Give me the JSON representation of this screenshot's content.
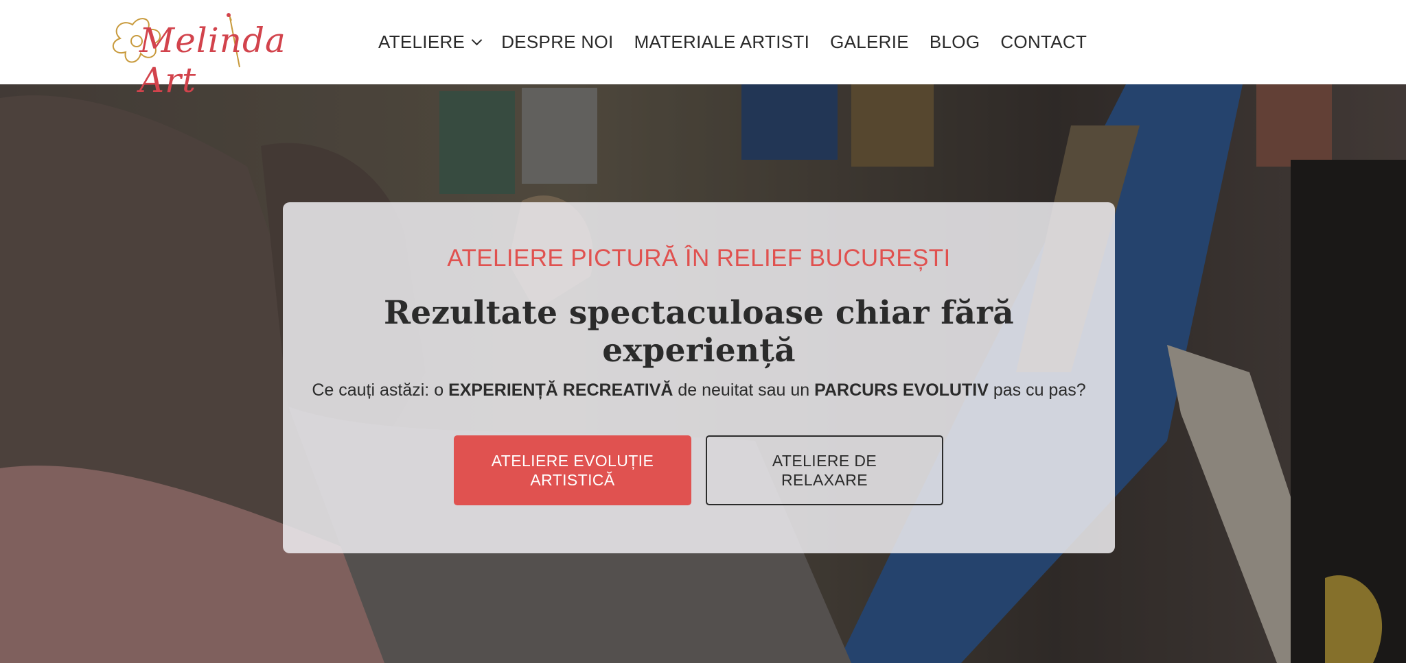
{
  "header": {
    "logo_text": "Melinda Art",
    "nav": [
      {
        "label": "ATELIERE",
        "has_dropdown": true
      },
      {
        "label": "DESPRE NOI"
      },
      {
        "label": "MATERIALE ARTISTI"
      },
      {
        "label": "GALERIE"
      },
      {
        "label": "BLOG"
      },
      {
        "label": "CONTACT"
      }
    ]
  },
  "hero": {
    "kicker": "ATELIERE PICTURĂ ÎN RELIEF BUCUREȘTI",
    "headline": "Rezultate spectaculoase chiar fără experiență",
    "tagline": {
      "part1": "Ce cauți astăzi: o ",
      "bold1": "EXPERIENȚĂ RECREATIVĂ",
      "part2": " de neuitat sau un ",
      "bold2": "PARCURS EVOLUTIV",
      "part3": " pas cu pas?"
    },
    "primary_button": "ATELIERE EVOLUȚIE ARTISTICĂ",
    "secondary_button": "ATELIERE DE RELAXARE"
  },
  "colors": {
    "accent": "#e05250",
    "text": "#2b2b2b",
    "card_bg": "#eeecf0"
  },
  "icons": {
    "logo": "flower-logo-icon",
    "dropdown": "chevron-down-icon"
  }
}
